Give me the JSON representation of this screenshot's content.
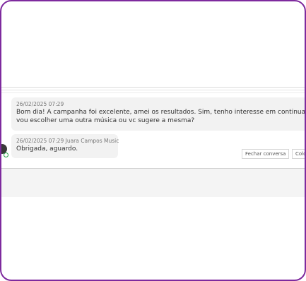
{
  "messages": [
    {
      "meta": "26/02/2025 07:29",
      "line1": "Bom dia! A campanha foi excelente, amei os resultados. Sim, tenho interesse em continuar, porém,",
      "line2": "vou escolher uma outra música ou vc sugere a mesma?"
    },
    {
      "meta": "26/02/2025 07:29 Juara Campos Music",
      "line1": "Obrigada, aguardo."
    }
  ],
  "actions": {
    "close_label": "Fechar conversa",
    "other_label": "Colo"
  },
  "colors": {
    "frame": "#7e2a9e",
    "bubble": "#f2f2f2",
    "whatsapp": "#25a244"
  }
}
